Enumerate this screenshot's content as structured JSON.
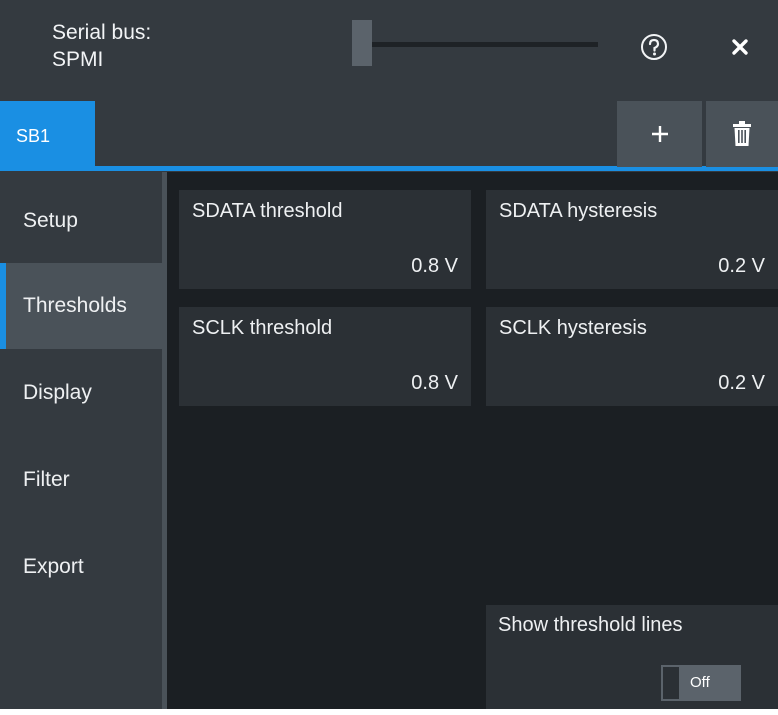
{
  "dialog": {
    "title_line1": "Serial bus:",
    "title_line2": "SPMI",
    "help_icon": "question-circle-icon",
    "close_icon": "close-x-icon"
  },
  "tabs": {
    "items": [
      {
        "label": "SB1",
        "active": true
      }
    ],
    "add_icon": "plus-icon",
    "delete_icon": "trash-icon"
  },
  "sidebar": {
    "items": [
      {
        "label": "Setup",
        "active": false
      },
      {
        "label": "Thresholds",
        "active": true
      },
      {
        "label": "Display",
        "active": false
      },
      {
        "label": "Filter",
        "active": false
      },
      {
        "label": "Export",
        "active": false
      }
    ]
  },
  "thresholds": {
    "sdata_threshold": {
      "label": "SDATA threshold",
      "value": "0.8 V"
    },
    "sdata_hysteresis": {
      "label": "SDATA hysteresis",
      "value": "0.2 V"
    },
    "sclk_threshold": {
      "label": "SCLK threshold",
      "value": "0.8 V"
    },
    "sclk_hysteresis": {
      "label": "SCLK hysteresis",
      "value": "0.2 V"
    }
  },
  "show_threshold_lines": {
    "label": "Show threshold lines",
    "state": "Off"
  },
  "colors": {
    "accent": "#1a8fe3",
    "header_bg": "#343a40",
    "panel_bg": "#1b1f23",
    "field_bg": "#2b3035",
    "button_bg": "#4a5259"
  }
}
